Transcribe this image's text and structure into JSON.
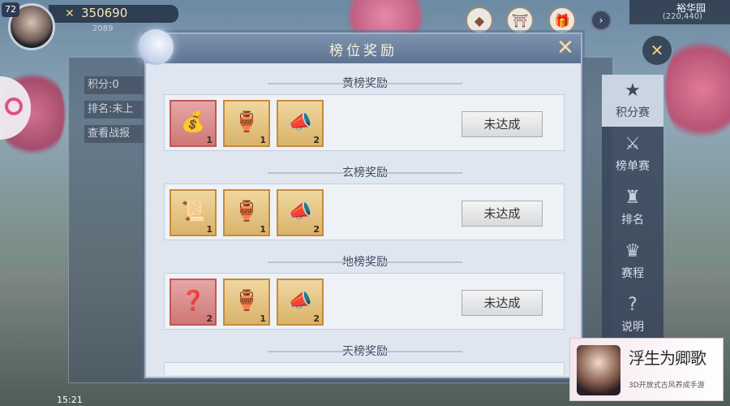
{
  "hud": {
    "level": "72",
    "power": "350690",
    "sub_number": "2089",
    "map_name": "裕华园",
    "map_coord": "(220,440)",
    "clock": "15:21"
  },
  "bg_panel": {
    "score_label": "积分:0",
    "rank_label": "排名:未上",
    "view_report_label": "查看战报"
  },
  "side_nav": [
    {
      "label": "积分赛",
      "icon": "stars-icon"
    },
    {
      "label": "榜单赛",
      "icon": "swords-icon"
    },
    {
      "label": "排名",
      "icon": "podium-icon"
    },
    {
      "label": "赛程",
      "icon": "trophy-icon"
    },
    {
      "label": "说明",
      "icon": "question-icon"
    }
  ],
  "modal": {
    "title": "榜位奖励",
    "sections": [
      {
        "title": "黄榜奖励",
        "button": "未达成",
        "items": [
          {
            "icon": "gold-pouch-icon",
            "count": "1",
            "variant": "red"
          },
          {
            "icon": "flower-vase-icon",
            "count": "1",
            "variant": "gold"
          },
          {
            "icon": "horn-icon",
            "count": "2",
            "variant": "gold"
          }
        ]
      },
      {
        "title": "玄榜奖励",
        "button": "未达成",
        "items": [
          {
            "icon": "scroll-box-icon",
            "count": "1",
            "variant": "gold"
          },
          {
            "icon": "flower-vase-icon",
            "count": "1",
            "variant": "gold"
          },
          {
            "icon": "horn-icon",
            "count": "2",
            "variant": "gold"
          }
        ]
      },
      {
        "title": "地榜奖励",
        "button": "未达成",
        "items": [
          {
            "icon": "mystery-token-icon",
            "count": "2",
            "variant": "red"
          },
          {
            "icon": "flower-vase-icon",
            "count": "1",
            "variant": "gold"
          },
          {
            "icon": "horn-icon",
            "count": "2",
            "variant": "gold"
          }
        ]
      },
      {
        "title": "天榜奖励"
      }
    ]
  },
  "promo": {
    "title": "浮生为卿歌",
    "subtitle": "3D开放式古风养成手游"
  },
  "colors": {
    "modal_bg": "#dfe6ef",
    "header": "#6b8099",
    "item_gold": "#d9b36a",
    "item_red": "#cf7676"
  }
}
